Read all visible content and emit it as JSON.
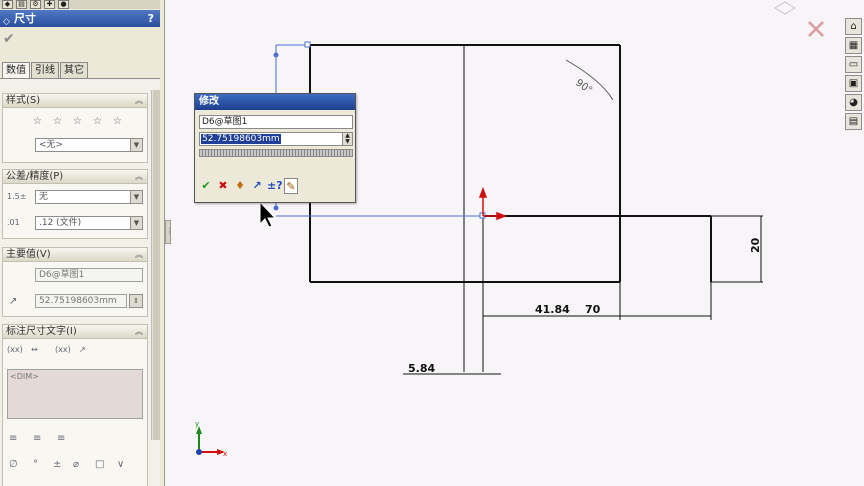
{
  "pm": {
    "title": "尺寸",
    "help": "?",
    "ok_icon": "✔",
    "tabs": [
      "数值",
      "引线",
      "其它"
    ],
    "style": {
      "header": "样式(S)",
      "combo": "<无>"
    },
    "tolerance": {
      "header": "公差/精度(P)",
      "type": "无",
      "precision": ".12 (文件)"
    },
    "primary": {
      "header": "主要值(V)",
      "name": "D6@草图1",
      "value": "52.75198603mm"
    },
    "dimtext": {
      "header": "标注尺寸文字(I)",
      "text": "<DIM>"
    }
  },
  "dialog": {
    "title": "修改",
    "name": "D6@草图1",
    "value": "52.75198603mm"
  },
  "drawing": {
    "dims": [
      "41.84",
      "70",
      "20",
      "5.84",
      "90°"
    ]
  },
  "colors": {
    "titlebar": "#2b4fa0",
    "accent_red": "#d01010",
    "accent_green": "#1a8a1a",
    "blue_line": "#4a6fd0"
  }
}
